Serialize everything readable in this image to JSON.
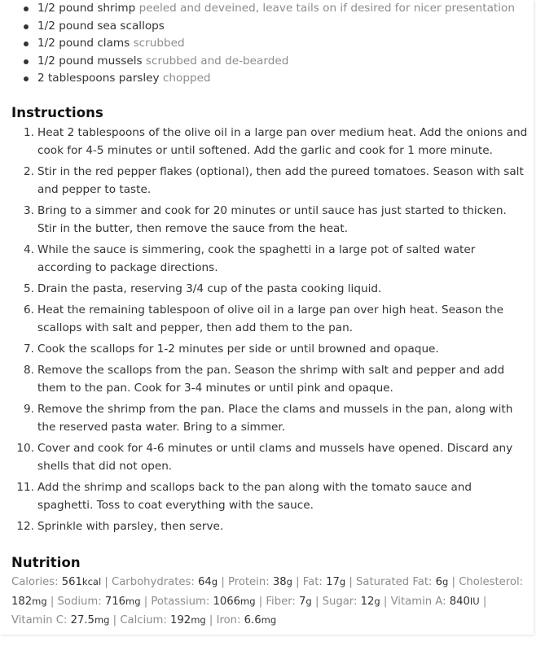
{
  "ingredients": [
    {
      "amount": "1/2 pound shrimp",
      "note": "peeled and deveined, leave tails on if desired for nicer presentation"
    },
    {
      "amount": "1/2 pound sea scallops",
      "note": ""
    },
    {
      "amount": "1/2 pound clams",
      "note": "scrubbed"
    },
    {
      "amount": "1/2 pound mussels",
      "note": "scrubbed and de-bearded"
    },
    {
      "amount": "2 tablespoons parsley",
      "note": "chopped"
    }
  ],
  "instructions_heading": "Instructions",
  "steps": [
    {
      "num": "1.",
      "text": "Heat 2 tablespoons of the olive oil in a large pan over medium heat. Add the onions and cook for 4-5 minutes or until softened. Add the garlic and cook for 1 more minute."
    },
    {
      "num": "2.",
      "text": "Stir in the red pepper flakes (optional), then add the pureed tomatoes. Season with salt and pepper to taste."
    },
    {
      "num": "3.",
      "text": "Bring to a simmer and cook for 20 minutes or until sauce has just started to thicken. Stir in the butter, then remove the sauce from the heat."
    },
    {
      "num": "4.",
      "text": "While the sauce is simmering, cook the spaghetti in a large pot of salted water according to package directions."
    },
    {
      "num": "5.",
      "text": "Drain the pasta, reserving 3/4 cup of the pasta cooking liquid."
    },
    {
      "num": "6.",
      "text": "Heat the remaining tablespoon of olive oil in a large pan over high heat. Season the scallops with salt and pepper, then add them to the pan."
    },
    {
      "num": "7.",
      "text": "Cook the scallops for 1-2 minutes per side or until browned and opaque."
    },
    {
      "num": "8.",
      "text": "Remove the scallops from the pan. Season the shrimp with salt and pepper and add them to the pan. Cook for 3-4 minutes or until pink and opaque."
    },
    {
      "num": "9.",
      "text": "Remove the shrimp from the pan. Place the clams and mussels in the pan, along with the reserved pasta water. Bring to a simmer."
    },
    {
      "num": "10.",
      "text": "Cover and cook for 4-6 minutes or until clams and mussels have opened. Discard any shells that did not open."
    },
    {
      "num": "11.",
      "text": "Add the shrimp and scallops back to the pan along with the tomato sauce and spaghetti. Toss to coat everything with the sauce."
    },
    {
      "num": "12.",
      "text": "Sprinkle with parsley, then serve."
    }
  ],
  "nutrition_heading": "Nutrition",
  "nutrition": [
    {
      "label": "Calories:",
      "value": "561",
      "unit": "kcal"
    },
    {
      "label": "Carbohydrates:",
      "value": "64",
      "unit": "g"
    },
    {
      "label": "Protein:",
      "value": "38",
      "unit": "g"
    },
    {
      "label": "Fat:",
      "value": "17",
      "unit": "g"
    },
    {
      "label": "Saturated Fat:",
      "value": "6",
      "unit": "g"
    },
    {
      "label": "Cholesterol:",
      "value": "182",
      "unit": "mg"
    },
    {
      "label": "Sodium:",
      "value": "716",
      "unit": "mg"
    },
    {
      "label": "Potassium:",
      "value": "1066",
      "unit": "mg"
    },
    {
      "label": "Fiber:",
      "value": "7",
      "unit": "g"
    },
    {
      "label": "Sugar:",
      "value": "12",
      "unit": "g"
    },
    {
      "label": "Vitamin A:",
      "value": "840",
      "unit": "IU"
    },
    {
      "label": "Vitamin C:",
      "value": "27.5",
      "unit": "mg"
    },
    {
      "label": "Calcium:",
      "value": "192",
      "unit": "mg"
    },
    {
      "label": "Iron:",
      "value": "6.6",
      "unit": "mg"
    }
  ],
  "nutrition_separator": "|"
}
